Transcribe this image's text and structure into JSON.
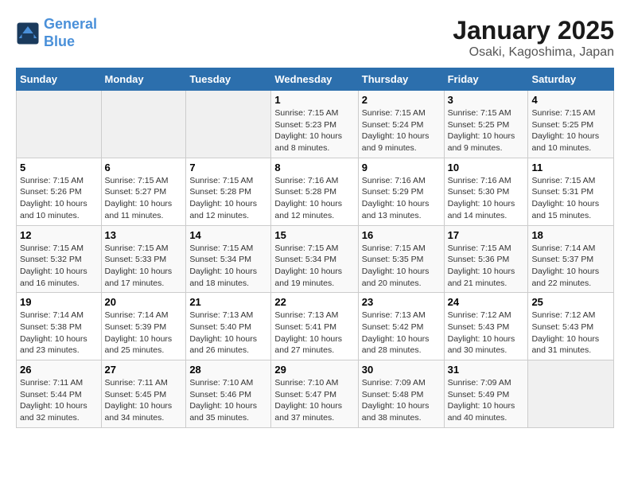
{
  "header": {
    "logo_line1": "General",
    "logo_line2": "Blue",
    "title": "January 2025",
    "subtitle": "Osaki, Kagoshima, Japan"
  },
  "weekdays": [
    "Sunday",
    "Monday",
    "Tuesday",
    "Wednesday",
    "Thursday",
    "Friday",
    "Saturday"
  ],
  "weeks": [
    [
      {
        "day": "",
        "info": ""
      },
      {
        "day": "",
        "info": ""
      },
      {
        "day": "",
        "info": ""
      },
      {
        "day": "1",
        "info": "Sunrise: 7:15 AM\nSunset: 5:23 PM\nDaylight: 10 hours\nand 8 minutes."
      },
      {
        "day": "2",
        "info": "Sunrise: 7:15 AM\nSunset: 5:24 PM\nDaylight: 10 hours\nand 9 minutes."
      },
      {
        "day": "3",
        "info": "Sunrise: 7:15 AM\nSunset: 5:25 PM\nDaylight: 10 hours\nand 9 minutes."
      },
      {
        "day": "4",
        "info": "Sunrise: 7:15 AM\nSunset: 5:25 PM\nDaylight: 10 hours\nand 10 minutes."
      }
    ],
    [
      {
        "day": "5",
        "info": "Sunrise: 7:15 AM\nSunset: 5:26 PM\nDaylight: 10 hours\nand 10 minutes."
      },
      {
        "day": "6",
        "info": "Sunrise: 7:15 AM\nSunset: 5:27 PM\nDaylight: 10 hours\nand 11 minutes."
      },
      {
        "day": "7",
        "info": "Sunrise: 7:15 AM\nSunset: 5:28 PM\nDaylight: 10 hours\nand 12 minutes."
      },
      {
        "day": "8",
        "info": "Sunrise: 7:16 AM\nSunset: 5:28 PM\nDaylight: 10 hours\nand 12 minutes."
      },
      {
        "day": "9",
        "info": "Sunrise: 7:16 AM\nSunset: 5:29 PM\nDaylight: 10 hours\nand 13 minutes."
      },
      {
        "day": "10",
        "info": "Sunrise: 7:16 AM\nSunset: 5:30 PM\nDaylight: 10 hours\nand 14 minutes."
      },
      {
        "day": "11",
        "info": "Sunrise: 7:15 AM\nSunset: 5:31 PM\nDaylight: 10 hours\nand 15 minutes."
      }
    ],
    [
      {
        "day": "12",
        "info": "Sunrise: 7:15 AM\nSunset: 5:32 PM\nDaylight: 10 hours\nand 16 minutes."
      },
      {
        "day": "13",
        "info": "Sunrise: 7:15 AM\nSunset: 5:33 PM\nDaylight: 10 hours\nand 17 minutes."
      },
      {
        "day": "14",
        "info": "Sunrise: 7:15 AM\nSunset: 5:34 PM\nDaylight: 10 hours\nand 18 minutes."
      },
      {
        "day": "15",
        "info": "Sunrise: 7:15 AM\nSunset: 5:34 PM\nDaylight: 10 hours\nand 19 minutes."
      },
      {
        "day": "16",
        "info": "Sunrise: 7:15 AM\nSunset: 5:35 PM\nDaylight: 10 hours\nand 20 minutes."
      },
      {
        "day": "17",
        "info": "Sunrise: 7:15 AM\nSunset: 5:36 PM\nDaylight: 10 hours\nand 21 minutes."
      },
      {
        "day": "18",
        "info": "Sunrise: 7:14 AM\nSunset: 5:37 PM\nDaylight: 10 hours\nand 22 minutes."
      }
    ],
    [
      {
        "day": "19",
        "info": "Sunrise: 7:14 AM\nSunset: 5:38 PM\nDaylight: 10 hours\nand 23 minutes."
      },
      {
        "day": "20",
        "info": "Sunrise: 7:14 AM\nSunset: 5:39 PM\nDaylight: 10 hours\nand 25 minutes."
      },
      {
        "day": "21",
        "info": "Sunrise: 7:13 AM\nSunset: 5:40 PM\nDaylight: 10 hours\nand 26 minutes."
      },
      {
        "day": "22",
        "info": "Sunrise: 7:13 AM\nSunset: 5:41 PM\nDaylight: 10 hours\nand 27 minutes."
      },
      {
        "day": "23",
        "info": "Sunrise: 7:13 AM\nSunset: 5:42 PM\nDaylight: 10 hours\nand 28 minutes."
      },
      {
        "day": "24",
        "info": "Sunrise: 7:12 AM\nSunset: 5:43 PM\nDaylight: 10 hours\nand 30 minutes."
      },
      {
        "day": "25",
        "info": "Sunrise: 7:12 AM\nSunset: 5:43 PM\nDaylight: 10 hours\nand 31 minutes."
      }
    ],
    [
      {
        "day": "26",
        "info": "Sunrise: 7:11 AM\nSunset: 5:44 PM\nDaylight: 10 hours\nand 32 minutes."
      },
      {
        "day": "27",
        "info": "Sunrise: 7:11 AM\nSunset: 5:45 PM\nDaylight: 10 hours\nand 34 minutes."
      },
      {
        "day": "28",
        "info": "Sunrise: 7:10 AM\nSunset: 5:46 PM\nDaylight: 10 hours\nand 35 minutes."
      },
      {
        "day": "29",
        "info": "Sunrise: 7:10 AM\nSunset: 5:47 PM\nDaylight: 10 hours\nand 37 minutes."
      },
      {
        "day": "30",
        "info": "Sunrise: 7:09 AM\nSunset: 5:48 PM\nDaylight: 10 hours\nand 38 minutes."
      },
      {
        "day": "31",
        "info": "Sunrise: 7:09 AM\nSunset: 5:49 PM\nDaylight: 10 hours\nand 40 minutes."
      },
      {
        "day": "",
        "info": ""
      }
    ]
  ]
}
